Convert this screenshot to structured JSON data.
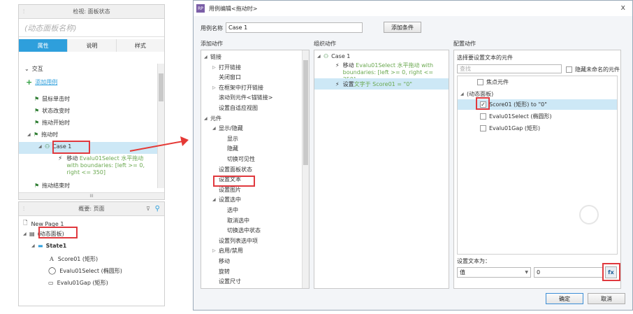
{
  "left_panel": {
    "title": "检视: 面板状态",
    "state_name_placeholder": "(动态面板名称)",
    "tabs": [
      "属性",
      "说明",
      "样式"
    ],
    "section": "交互",
    "add_case": "添加用例",
    "events": [
      "鼠标单击时",
      "状态改变时",
      "拖动开始时",
      "拖动时"
    ],
    "case_label": "Case 1",
    "action_prefix": "移动 ",
    "action_text": "Evalu01Select 水平拖动 with boundaries: [left >= 0, right <= 350]",
    "drag_end": "拖动结束时",
    "scroll_label": "III"
  },
  "outline_panel": {
    "title": "概要: 页面",
    "page": "New Page 1",
    "dyn_panel": "(动态面板)",
    "state": "State1",
    "items": [
      "Score01 (矩形)",
      "Evalu01Select (椭圆形)",
      "Evalu01Gap (矩形)"
    ]
  },
  "dialog": {
    "title": "用例编辑<拖动时>",
    "case_name_label": "用例名称",
    "case_name_value": "Case 1",
    "add_condition": "添加条件",
    "col1_header": "添加动作",
    "col2_header": "组织动作",
    "col3_header": "配置动作",
    "actions": [
      {
        "t": "链接",
        "lvl": 0,
        "exp": "open"
      },
      {
        "t": "打开链接",
        "lvl": 1,
        "exp": "closed"
      },
      {
        "t": "关闭窗口",
        "lvl": 1,
        "exp": ""
      },
      {
        "t": "在框架中打开链接",
        "lvl": 1,
        "exp": "closed"
      },
      {
        "t": "滚动到元件<锚链接>",
        "lvl": 1,
        "exp": ""
      },
      {
        "t": "设置自适应视图",
        "lvl": 1,
        "exp": ""
      },
      {
        "t": "元件",
        "lvl": 0,
        "exp": "open"
      },
      {
        "t": "显示/隐藏",
        "lvl": 1,
        "exp": "open"
      },
      {
        "t": "显示",
        "lvl": 2,
        "exp": ""
      },
      {
        "t": "隐藏",
        "lvl": 2,
        "exp": ""
      },
      {
        "t": "切换可见性",
        "lvl": 2,
        "exp": ""
      },
      {
        "t": "设置面板状态",
        "lvl": 1,
        "exp": ""
      },
      {
        "t": "设置文本",
        "lvl": 1,
        "exp": ""
      },
      {
        "t": "设置图片",
        "lvl": 1,
        "exp": ""
      },
      {
        "t": "设置选中",
        "lvl": 1,
        "exp": "open"
      },
      {
        "t": "选中",
        "lvl": 2,
        "exp": ""
      },
      {
        "t": "取消选中",
        "lvl": 2,
        "exp": ""
      },
      {
        "t": "切换选中状态",
        "lvl": 2,
        "exp": ""
      },
      {
        "t": "设置列表选中项",
        "lvl": 1,
        "exp": ""
      },
      {
        "t": "启用/禁用",
        "lvl": 1,
        "exp": "closed"
      },
      {
        "t": "移动",
        "lvl": 1,
        "exp": ""
      },
      {
        "t": "旋转",
        "lvl": 1,
        "exp": ""
      },
      {
        "t": "设置尺寸",
        "lvl": 1,
        "exp": ""
      }
    ],
    "org_case": "Case 1",
    "org_action1_prefix": "移动 ",
    "org_action1": "Evalu01Select 水平拖动 with boundaries: [left >= 0, right <= 350]",
    "org_action2_prefix": "设置 ",
    "org_action2": "文字于 Score01 = \"0\"",
    "config_label": "选择要设置文本的元件",
    "search_placeholder": "查找",
    "hide_unnamed": "隐藏未命名的元件",
    "focus_widget": "焦点元件",
    "tree_panel": "(动态面板)",
    "w1": "Score01 (矩形) to \"0\"",
    "w2": "Evalu01Select (椭圆形)",
    "w3": "Evalu01Gap (矩形)",
    "set_text_to": "设置文本为：",
    "type_value": "值",
    "value": "0",
    "fx": "fx",
    "ok": "确定",
    "cancel": "取消",
    "close_x": "x"
  },
  "colors": {
    "accent_tab": "#2e9fdc",
    "highlight_row": "#cde8f6",
    "red_box": "#e0393e",
    "arrow": "#e53935"
  }
}
